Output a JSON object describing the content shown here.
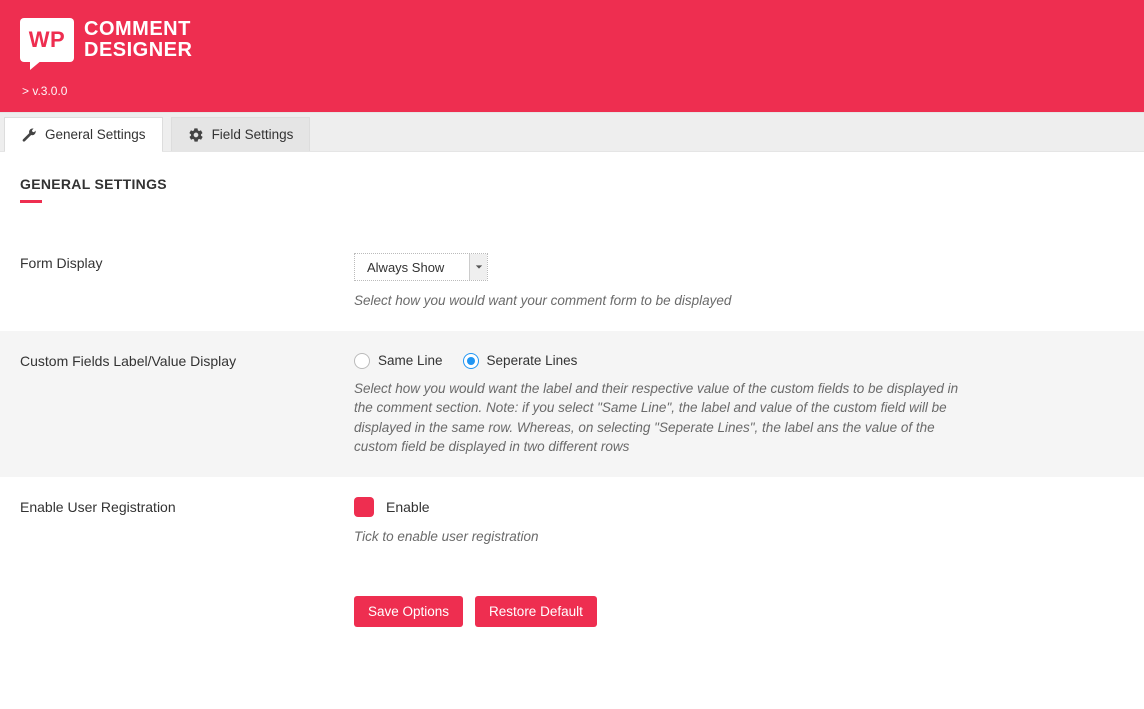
{
  "header": {
    "logo_badge_text": "WP",
    "logo_line1": "COMMENT",
    "logo_line2": "DESIGNER",
    "version": "> v.3.0.0"
  },
  "tabs": {
    "general": "General Settings",
    "field": "Field Settings"
  },
  "section": {
    "title": "GENERAL SETTINGS"
  },
  "form_display": {
    "label": "Form Display",
    "value": "Always Show",
    "help": "Select how you would want your comment form to be displayed"
  },
  "cf_display": {
    "label": "Custom Fields Label/Value Display",
    "option_same": "Same Line",
    "option_sep": "Seperate Lines",
    "selected": "sep",
    "help": "Select how you would want the label and their respective value of the custom fields to be displayed in the comment section. Note: if you select \"Same Line\", the label and value of the custom field will be displayed in the same row. Whereas, on selecting \"Seperate Lines\", the label ans the value of the custom field be displayed in two different rows"
  },
  "user_reg": {
    "label": "Enable User Registration",
    "check_label": "Enable",
    "help": "Tick to enable user registration"
  },
  "buttons": {
    "save": "Save Options",
    "restore": "Restore Default"
  }
}
